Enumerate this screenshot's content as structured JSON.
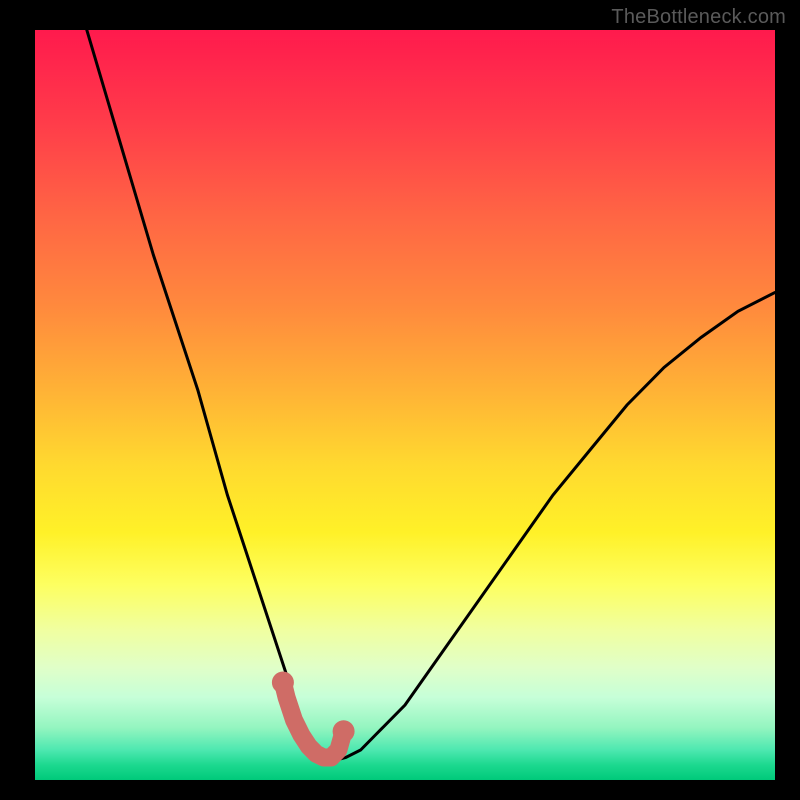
{
  "watermark": "TheBottleneck.com",
  "chart_data": {
    "type": "line",
    "title": "",
    "xlabel": "",
    "ylabel": "",
    "xlim": [
      0,
      100
    ],
    "ylim": [
      0,
      100
    ],
    "grid": false,
    "series": [
      {
        "name": "bottleneck-curve",
        "x": [
          7,
          10,
          13,
          16,
          19,
          22,
          24,
          26,
          28,
          30,
          32,
          34,
          35,
          36,
          37,
          38,
          39,
          40,
          42,
          44,
          46,
          50,
          55,
          60,
          65,
          70,
          75,
          80,
          85,
          90,
          95,
          100
        ],
        "y": [
          100,
          90,
          80,
          70,
          61,
          52,
          45,
          38,
          32,
          26,
          20,
          14,
          11,
          8,
          6,
          4,
          3,
          2.5,
          3,
          4,
          6,
          10,
          17,
          24,
          31,
          38,
          44,
          50,
          55,
          59,
          62.5,
          65
        ]
      },
      {
        "name": "highlight-segment",
        "x": [
          33.5,
          34,
          35,
          36,
          37,
          38,
          39,
          40,
          41,
          41.7
        ],
        "y": [
          13,
          11,
          8,
          6,
          4.5,
          3.5,
          3,
          3,
          4,
          6.5
        ]
      }
    ],
    "colors": {
      "curve": "#000000",
      "highlight": "#cf6c66"
    }
  }
}
